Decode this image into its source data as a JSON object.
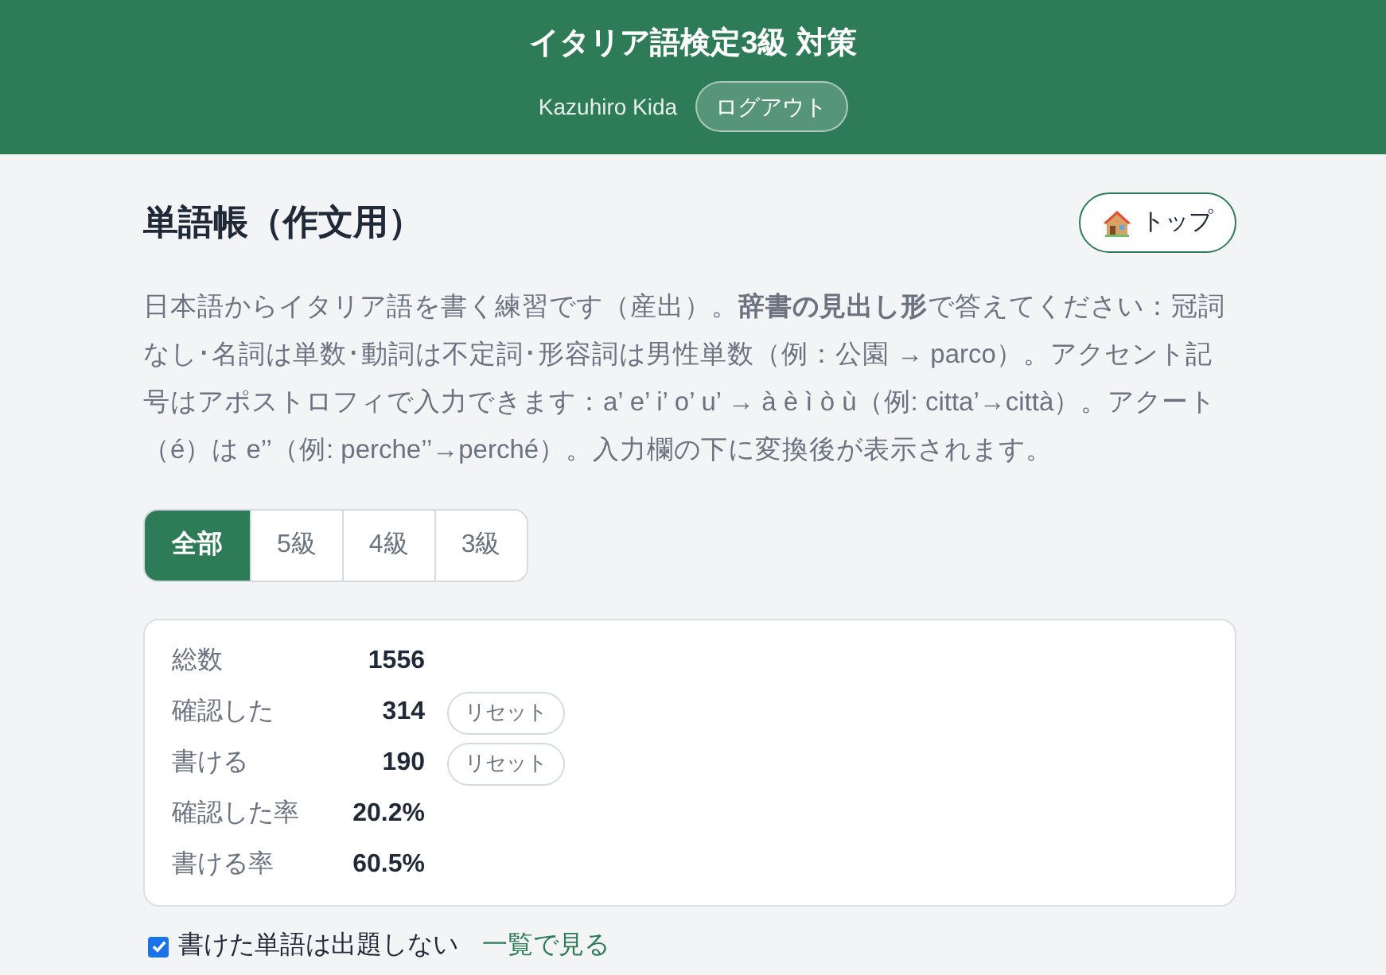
{
  "header": {
    "title": "イタリア語検定3級 対策",
    "user_name": "Kazuhiro Kida",
    "logout_button": "ログアウト"
  },
  "page": {
    "heading": "単語帳（作文用）",
    "top_button": "トップ",
    "description": "日本語からイタリア語を書く練習です（産出）。**辞書の見出し形**で答えてください：冠詞なし･名詞は単数･動詞は不定詞･形容詞は男性単数（例：公園 → parco）。アクセント記号はアポストロフィで入力できます：a’ e’ i’ o’ u’ → à è ì ò ù（例: citta’→città）。アクート（é）は e’’（例: perche’’→perché）。入力欄の下に変換後が表示されます。"
  },
  "level_tabs": [
    {
      "label": "全部",
      "selected": true
    },
    {
      "label": "5級",
      "selected": false
    },
    {
      "label": "4級",
      "selected": false
    },
    {
      "label": "3級",
      "selected": false
    }
  ],
  "stats": [
    {
      "label": "総数",
      "value": "1556"
    },
    {
      "label": "確認した",
      "value": "314",
      "reset_button": "リセット"
    },
    {
      "label": "書ける",
      "value": "190",
      "reset_button": "リセット"
    },
    {
      "label": "確認した率",
      "value": "20.2%"
    },
    {
      "label": "書ける率",
      "value": "60.5%"
    }
  ],
  "options": {
    "hide_written": {
      "label": "書けた単語は出題しない",
      "checked": true
    },
    "list_link": "一覧で見る"
  }
}
